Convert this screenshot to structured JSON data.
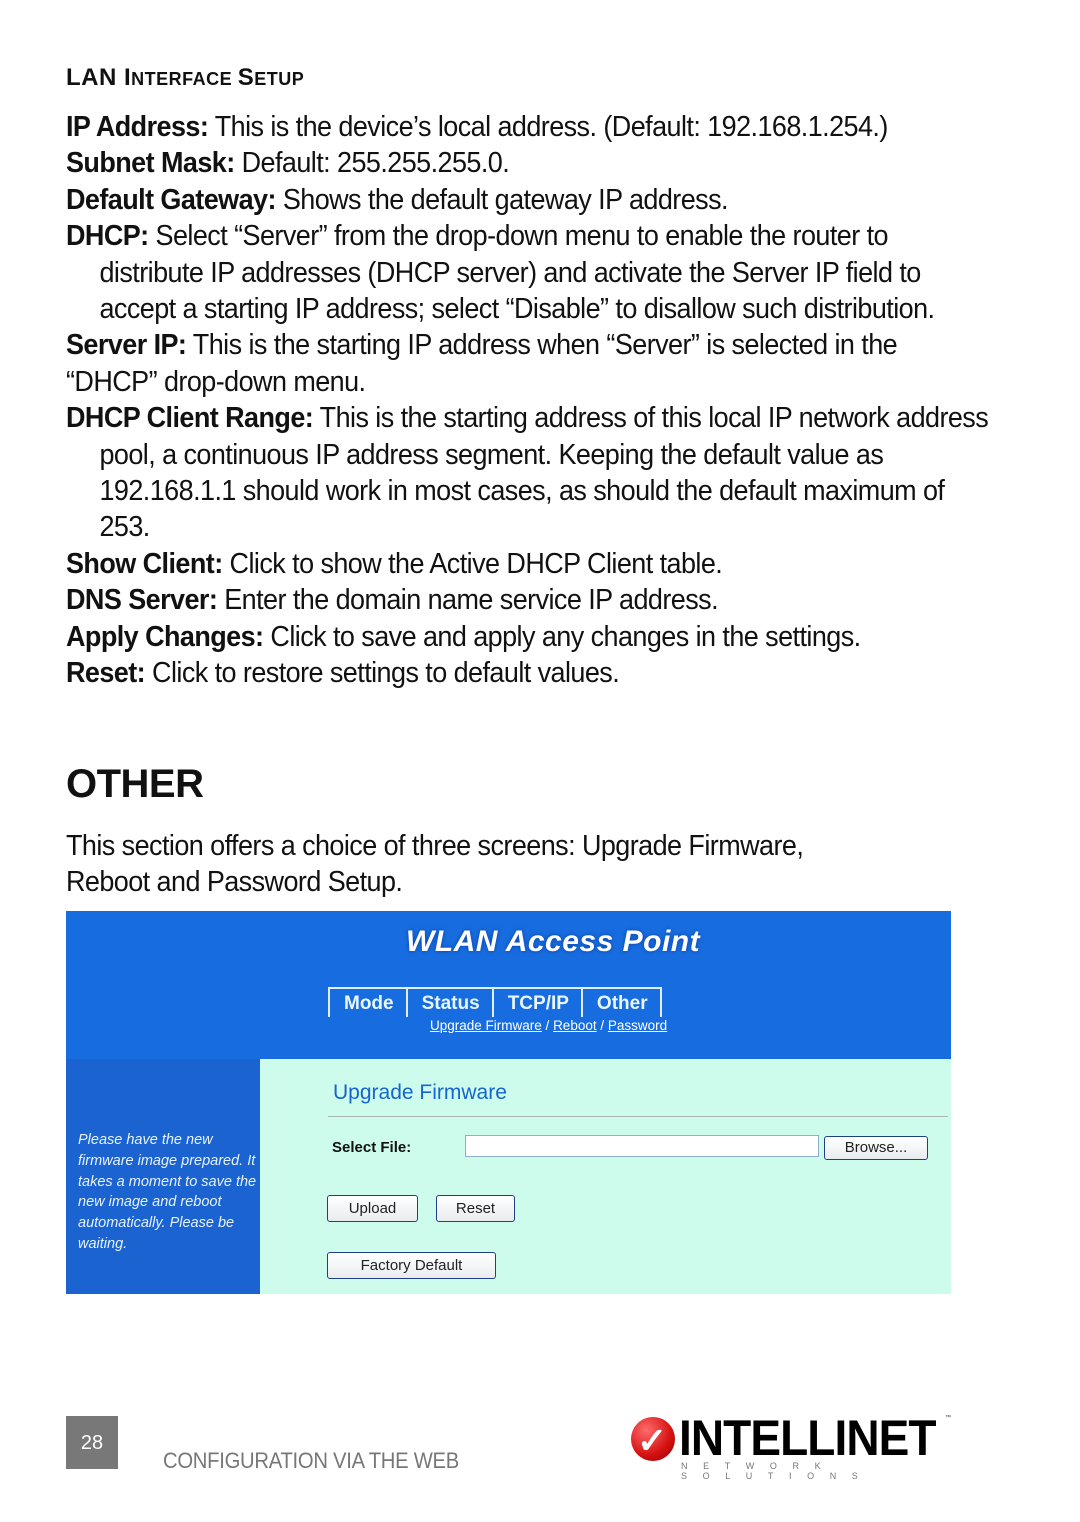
{
  "lan_section": {
    "heading_parts": [
      {
        "text": "LAN ",
        "small": false
      },
      {
        "text": "I",
        "small": false
      },
      {
        "text": "NTERFACE ",
        "small": true
      },
      {
        "text": "S",
        "small": false
      },
      {
        "text": "ETUP",
        "small": true
      }
    ],
    "items": [
      {
        "term": "IP Address:",
        "desc": " This is the device’s local address. (Default: 192.168.1.254.)"
      },
      {
        "term": "Subnet Mask:",
        "desc": " Default: 255.255.255.0."
      },
      {
        "term": "Default Gateway:",
        "desc": " Shows the default gateway IP address."
      },
      {
        "term": "DHCP:",
        "desc": " Select “Server” from the drop-down menu to enable the router to distribute IP addresses (DHCP server) and activate the Server IP field to accept a starting IP address; select “Disable” to disallow such distribution."
      },
      {
        "term": "Server IP:",
        "desc": " This is the starting IP address when “Server” is selected in the “DHCP” drop-down menu."
      },
      {
        "term": "DHCP Client Range:",
        "desc": " This is the starting address of this local IP network address pool, a continuous IP address segment. Keeping the default value as 192.168.1.1 should work in most cases, as should the default maximum of 253."
      },
      {
        "term": "Show Client:",
        "desc": " Click to show the Active DHCP Client table."
      },
      {
        "term": "DNS Server:",
        "desc": " Enter the domain name service IP address."
      },
      {
        "term": "Apply Changes:",
        "desc": " Click to save and apply any changes in the settings."
      },
      {
        "term": "Reset:",
        "desc": " Click to restore settings to default values."
      }
    ]
  },
  "other_section": {
    "title": "OTHER",
    "intro": "This section offers a choice of three screens: Upgrade Firmware, Reboot and Password Setup."
  },
  "screenshot": {
    "app_title": "WLAN Access Point",
    "tabs": [
      "Mode",
      "Status",
      "TCP/IP",
      "Other"
    ],
    "sublinks": [
      "Upgrade Firmware",
      "Reboot",
      "Password"
    ],
    "sublink_separator": " / ",
    "sidebar_text": "Please have the new firmware image prepared. It takes a moment to save the new image and reboot automatically. Please be waiting.",
    "page_title": "Upgrade Firmware",
    "select_file_label": "Select File:",
    "file_value": "",
    "browse_label": "Browse...",
    "upload_label": "Upload",
    "reset_label": "Reset",
    "factory_default_label": "Factory Default",
    "colors": {
      "header_blue": "#176ddf",
      "content_bg": "#cefcec",
      "title_blue": "#1565d0"
    }
  },
  "footer": {
    "page_number": "28",
    "chapter": "CONFIGURATION VIA THE WEB",
    "brand": "INTELLINET",
    "brand_tm": "™",
    "brand_sub": "NETWORK SOLUTIONS"
  }
}
